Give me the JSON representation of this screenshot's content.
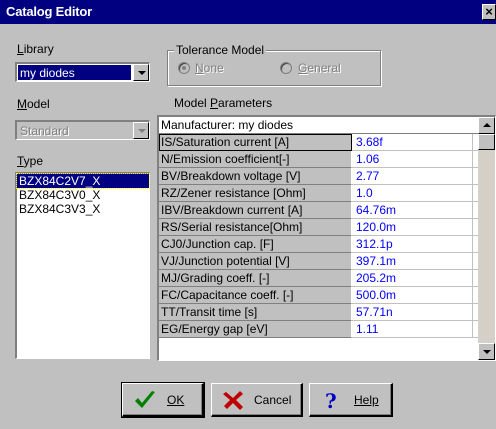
{
  "window": {
    "title": "Catalog Editor",
    "close_glyph": "×"
  },
  "library": {
    "label": "Library",
    "value": "my diodes"
  },
  "model": {
    "label": "Model",
    "value": "Standard"
  },
  "type": {
    "label": "Type",
    "items": [
      "BZX84C2V7_X",
      "BZX84C3V0_X",
      "BZX84C3V3_X"
    ]
  },
  "tolerance": {
    "label": "Tolerance Model",
    "none_label": "None",
    "general_label": "General"
  },
  "parameters": {
    "label": "Model Parameters",
    "manufacturer": "Manufacturer: my diodes",
    "rows": [
      {
        "name": "IS/Saturation current [A]",
        "value": "3.68f"
      },
      {
        "name": "N/Emission coefficient[-]",
        "value": "1.06"
      },
      {
        "name": "BV/Breakdown voltage  [V]",
        "value": "2.77"
      },
      {
        "name": "RZ/Zener resistance [Ohm]",
        "value": "1.0"
      },
      {
        "name": "IBV/Breakdown current [A]",
        "value": "64.76m"
      },
      {
        "name": "RS/Serial resistance[Ohm]",
        "value": "120.0m"
      },
      {
        "name": "CJ0/Junction cap.     [F]",
        "value": "312.1p"
      },
      {
        "name": "VJ/Junction potential [V]",
        "value": "397.1m"
      },
      {
        "name": "MJ/Grading coeff.    [-]",
        "value": "205.2m"
      },
      {
        "name": "FC/Capacitance coeff. [-]",
        "value": "500.0m"
      },
      {
        "name": "TT/Transit time       [s]",
        "value": "57.71n"
      },
      {
        "name": "EG/Energy gap        [eV]",
        "value": "1.11"
      }
    ]
  },
  "buttons": {
    "ok": "OK",
    "cancel": "Cancel",
    "help": "Help"
  },
  "icons": {
    "ok": "checkmark-icon",
    "cancel": "x-icon",
    "help": "question-icon"
  },
  "colors": {
    "title_bar": "#000080",
    "values": "#0000ff",
    "face": "#c0c0c0"
  }
}
